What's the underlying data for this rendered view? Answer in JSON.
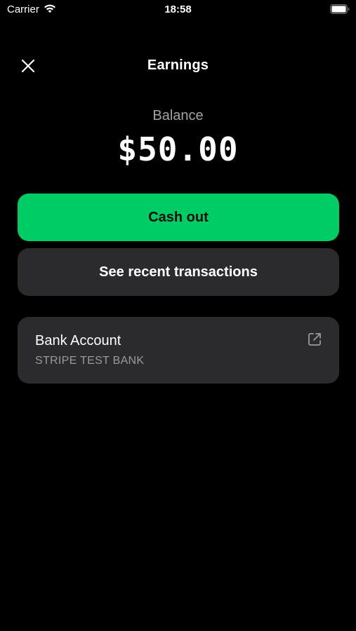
{
  "status_bar": {
    "carrier": "Carrier",
    "time": "18:58",
    "wifi_icon": "wifi-icon",
    "battery_icon": "battery-icon"
  },
  "header": {
    "title": "Earnings",
    "close_icon": "close-icon"
  },
  "balance": {
    "label": "Balance",
    "amount": "$50.00"
  },
  "actions": {
    "cash_out_label": "Cash out",
    "transactions_label": "See recent transactions"
  },
  "bank_account": {
    "title": "Bank Account",
    "bank_name": "STRIPE TEST BANK",
    "link_icon": "external-link-icon"
  },
  "colors": {
    "background": "#000000",
    "accent_green": "#00cc66",
    "card_background": "#2b2b2d",
    "secondary_text": "#a3a3a3"
  }
}
